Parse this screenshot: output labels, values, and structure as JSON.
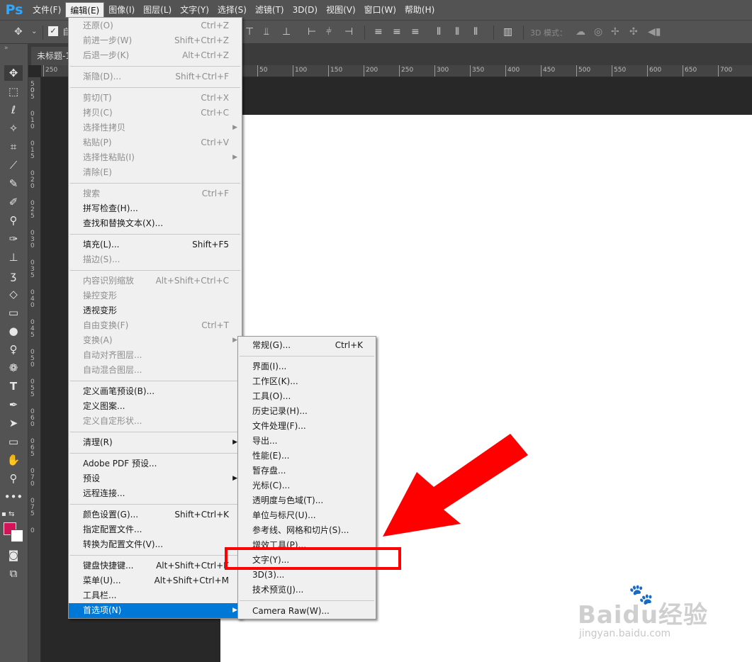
{
  "app": {
    "logo": "Ps",
    "document_tab": "未标题-1"
  },
  "menubar": [
    {
      "label": "文件(F)"
    },
    {
      "label": "编辑(E)",
      "active": true
    },
    {
      "label": "图像(I)"
    },
    {
      "label": "图层(L)"
    },
    {
      "label": "文字(Y)"
    },
    {
      "label": "选择(S)"
    },
    {
      "label": "滤镜(T)"
    },
    {
      "label": "3D(D)"
    },
    {
      "label": "视图(V)"
    },
    {
      "label": "窗口(W)"
    },
    {
      "label": "帮助(H)"
    }
  ],
  "options_bar": {
    "auto_select_label": "自",
    "mode_3d_label": "3D 模式："
  },
  "ruler": {
    "top_labels": [
      "250",
      "50",
      "100",
      "150",
      "200",
      "250",
      "300",
      "350",
      "400",
      "450",
      "500",
      "550",
      "600",
      "650",
      "700"
    ],
    "left_labels": [
      "50",
      "0",
      "5",
      "0",
      "1",
      "0",
      "0",
      "1",
      "5",
      "0",
      "2",
      "0",
      "0",
      "2",
      "5",
      "0",
      "3",
      "0",
      "0",
      "3",
      "5",
      "0",
      "4",
      "0",
      "0",
      "4",
      "5",
      "0",
      "5",
      "0",
      "0",
      "5",
      "5",
      "0",
      "6",
      "0",
      "0",
      "6",
      "5",
      "0",
      "7",
      "0",
      "0",
      "7",
      "5",
      "0"
    ]
  },
  "edit_menu": [
    {
      "label": "还原(O)",
      "shortcut": "Ctrl+Z",
      "disabled": true
    },
    {
      "label": "前进一步(W)",
      "shortcut": "Shift+Ctrl+Z",
      "disabled": true
    },
    {
      "label": "后退一步(K)",
      "shortcut": "Alt+Ctrl+Z",
      "disabled": true
    },
    {
      "sep": true
    },
    {
      "label": "渐隐(D)...",
      "shortcut": "Shift+Ctrl+F",
      "disabled": true
    },
    {
      "sep": true
    },
    {
      "label": "剪切(T)",
      "shortcut": "Ctrl+X",
      "disabled": true
    },
    {
      "label": "拷贝(C)",
      "shortcut": "Ctrl+C",
      "disabled": true
    },
    {
      "label": "选择性拷贝",
      "submenu": true,
      "disabled": true
    },
    {
      "label": "粘贴(P)",
      "shortcut": "Ctrl+V",
      "disabled": true
    },
    {
      "label": "选择性粘贴(I)",
      "submenu": true,
      "disabled": true
    },
    {
      "label": "清除(E)",
      "disabled": true
    },
    {
      "sep": true
    },
    {
      "label": "搜索",
      "shortcut": "Ctrl+F",
      "disabled": true
    },
    {
      "label": "拼写检查(H)..."
    },
    {
      "label": "查找和替换文本(X)..."
    },
    {
      "sep": true
    },
    {
      "label": "填充(L)...",
      "shortcut": "Shift+F5"
    },
    {
      "label": "描边(S)...",
      "disabled": true
    },
    {
      "sep": true
    },
    {
      "label": "内容识别缩放",
      "shortcut": "Alt+Shift+Ctrl+C",
      "disabled": true
    },
    {
      "label": "操控变形",
      "disabled": true
    },
    {
      "label": "透视变形"
    },
    {
      "label": "自由变换(F)",
      "shortcut": "Ctrl+T",
      "disabled": true
    },
    {
      "label": "变换(A)",
      "submenu": true,
      "disabled": true
    },
    {
      "label": "自动对齐图层...",
      "disabled": true
    },
    {
      "label": "自动混合图层...",
      "disabled": true
    },
    {
      "sep": true
    },
    {
      "label": "定义画笔预设(B)..."
    },
    {
      "label": "定义图案..."
    },
    {
      "label": "定义自定形状...",
      "disabled": true
    },
    {
      "sep": true
    },
    {
      "label": "清理(R)",
      "submenu": true
    },
    {
      "sep": true
    },
    {
      "label": "Adobe PDF 预设..."
    },
    {
      "label": "预设",
      "submenu": true
    },
    {
      "label": "远程连接..."
    },
    {
      "sep": true
    },
    {
      "label": "颜色设置(G)...",
      "shortcut": "Shift+Ctrl+K"
    },
    {
      "label": "指定配置文件..."
    },
    {
      "label": "转换为配置文件(V)..."
    },
    {
      "sep": true
    },
    {
      "label": "键盘快捷键...",
      "shortcut": "Alt+Shift+Ctrl+K"
    },
    {
      "label": "菜单(U)...",
      "shortcut": "Alt+Shift+Ctrl+M"
    },
    {
      "label": "工具栏..."
    },
    {
      "label": "首选项(N)",
      "submenu": true,
      "selected": true
    }
  ],
  "prefs_menu": [
    {
      "label": "常规(G)...",
      "shortcut": "Ctrl+K"
    },
    {
      "sep": true
    },
    {
      "label": "界面(I)..."
    },
    {
      "label": "工作区(K)..."
    },
    {
      "label": "工具(O)..."
    },
    {
      "label": "历史记录(H)..."
    },
    {
      "label": "文件处理(F)..."
    },
    {
      "label": "导出..."
    },
    {
      "label": "性能(E)..."
    },
    {
      "label": "暂存盘..."
    },
    {
      "label": "光标(C)..."
    },
    {
      "label": "透明度与色域(T)..."
    },
    {
      "label": "单位与标尺(U)..."
    },
    {
      "label": "参考线、网格和切片(S)..."
    },
    {
      "label": "增效工具(P)..."
    },
    {
      "label": "文字(Y)...",
      "highlighted": true
    },
    {
      "label": "3D(3)..."
    },
    {
      "label": "技术预览(J)..."
    },
    {
      "sep": true
    },
    {
      "label": "Camera Raw(W)..."
    }
  ],
  "annotation": {
    "highlight_color": "#ff0000",
    "arrow_color": "#ff0000"
  },
  "watermark": {
    "brand": "Baidu经验",
    "url": "jingyan.baidu.com"
  },
  "colors": {
    "foreground": "#d4145a",
    "background": "#ffffff",
    "menu_selected": "#0078d7"
  }
}
